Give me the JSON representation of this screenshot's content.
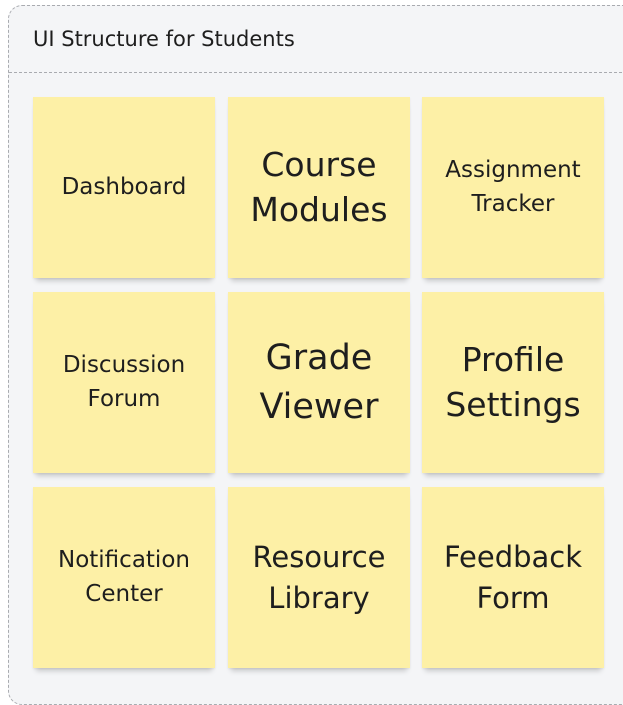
{
  "frame": {
    "title": "UI Structure for Students"
  },
  "notes": [
    {
      "label": "Dashboard"
    },
    {
      "label": "Course\nModules"
    },
    {
      "label": "Assignment\nTracker"
    },
    {
      "label": "Discussion\nForum"
    },
    {
      "label": "Grade\nViewer"
    },
    {
      "label": "Profile\nSettings"
    },
    {
      "label": "Notification\nCenter"
    },
    {
      "label": "Resource\nLibrary"
    },
    {
      "label": "Feedback\nForm"
    }
  ],
  "colors": {
    "note_fill": "#fdf0a6",
    "frame_fill": "#f4f5f7",
    "frame_border": "#a9abb0"
  }
}
